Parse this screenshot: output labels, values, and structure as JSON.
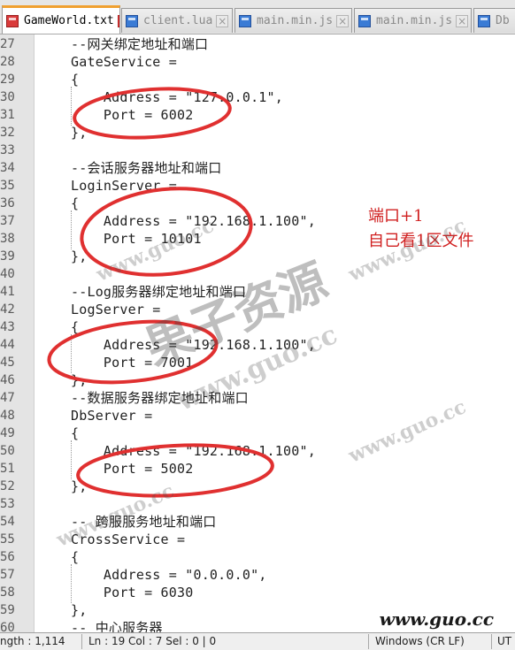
{
  "tabs": [
    {
      "label": "GameWorld.txt",
      "icon": "file-red-icon",
      "active": true
    },
    {
      "label": "client.lua",
      "icon": "file-blue-icon",
      "active": false
    },
    {
      "label": "main.min.js",
      "icon": "file-blue-icon",
      "active": false
    },
    {
      "label": "main.min.js",
      "icon": "file-blue-icon",
      "active": false
    },
    {
      "label": "Db",
      "icon": "file-blue-icon",
      "active": false
    }
  ],
  "lines": [
    {
      "n": "27",
      "text": "--网关绑定地址和端口"
    },
    {
      "n": "28",
      "text": "GateService ="
    },
    {
      "n": "29",
      "text": "{"
    },
    {
      "n": "30",
      "text": "    Address = \"127.0.0.1\","
    },
    {
      "n": "31",
      "text": "    Port = 6002"
    },
    {
      "n": "32",
      "text": "},"
    },
    {
      "n": "33",
      "text": ""
    },
    {
      "n": "34",
      "text": "--会话服务器地址和端口"
    },
    {
      "n": "35",
      "text": "LoginServer ="
    },
    {
      "n": "36",
      "text": "{"
    },
    {
      "n": "37",
      "text": "    Address = \"192.168.1.100\","
    },
    {
      "n": "38",
      "text": "    Port = 10101"
    },
    {
      "n": "39",
      "text": "},"
    },
    {
      "n": "40",
      "text": ""
    },
    {
      "n": "41",
      "text": "--Log服务器绑定地址和端口"
    },
    {
      "n": "42",
      "text": "LogServer ="
    },
    {
      "n": "43",
      "text": "{"
    },
    {
      "n": "44",
      "text": "    Address = \"192.168.1.100\","
    },
    {
      "n": "45",
      "text": "    Port = 7001"
    },
    {
      "n": "46",
      "text": "},"
    },
    {
      "n": "47",
      "text": "--数据服务器绑定地址和端口"
    },
    {
      "n": "48",
      "text": "DbServer ="
    },
    {
      "n": "49",
      "text": "{"
    },
    {
      "n": "50",
      "text": "    Address = \"192.168.1.100\","
    },
    {
      "n": "51",
      "text": "    Port = 5002"
    },
    {
      "n": "52",
      "text": "},"
    },
    {
      "n": "53",
      "text": ""
    },
    {
      "n": "54",
      "text": "-- 跨服服务地址和端口"
    },
    {
      "n": "55",
      "text": "CrossService ="
    },
    {
      "n": "56",
      "text": "{"
    },
    {
      "n": "57",
      "text": "    Address = \"0.0.0.0\","
    },
    {
      "n": "58",
      "text": "    Port = 6030"
    },
    {
      "n": "59",
      "text": "},"
    },
    {
      "n": "60",
      "text": "-- 中心服务器"
    }
  ],
  "annotation": {
    "line1": "端口+1",
    "line2": "自己看1区文件",
    "color": "#d02020"
  },
  "watermark": {
    "big": "果子资源",
    "url": "www.guo.cc",
    "corner": "www.guo.cc"
  },
  "statusbar": {
    "length": "ngth : 1,114",
    "position": "Ln : 19    Col : 7    Sel : 0 | 0",
    "eol": "Windows (CR LF)",
    "encoding": "UT"
  }
}
